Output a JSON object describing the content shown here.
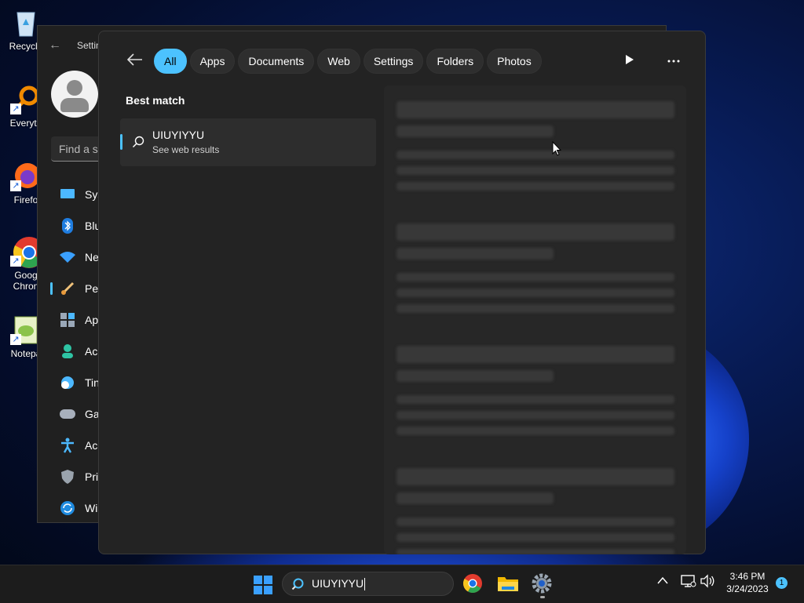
{
  "desktop": {
    "icons": [
      {
        "label": "Recycle",
        "icon": "recycle-bin-icon"
      },
      {
        "label": "Everyth",
        "icon": "everything-search-icon"
      },
      {
        "label": "Firefo",
        "icon": "firefox-icon"
      },
      {
        "label": "Goog\nChron",
        "icon": "chrome-icon"
      },
      {
        "label": "Notepa",
        "icon": "notepad-plus-icon"
      }
    ]
  },
  "settings": {
    "title": "Settin",
    "find_placeholder": "Find a se",
    "nav": [
      {
        "label": "Sys",
        "icon": "system-icon"
      },
      {
        "label": "Blu",
        "icon": "bluetooth-icon"
      },
      {
        "label": "Ne",
        "icon": "network-icon"
      },
      {
        "label": "Per",
        "icon": "personalization-icon",
        "active": true
      },
      {
        "label": "Ap",
        "icon": "apps-icon"
      },
      {
        "label": "Ac",
        "icon": "accounts-icon"
      },
      {
        "label": "Tin",
        "icon": "time-language-icon"
      },
      {
        "label": "Ga",
        "icon": "gaming-icon"
      },
      {
        "label": "Ac",
        "icon": "accessibility-icon"
      },
      {
        "label": "Pri",
        "icon": "privacy-icon"
      },
      {
        "label": "Wi",
        "icon": "windows-update-icon"
      }
    ]
  },
  "search_panel": {
    "filters": [
      "All",
      "Apps",
      "Documents",
      "Web",
      "Settings",
      "Folders",
      "Photos"
    ],
    "selected_filter": "All",
    "best_match_label": "Best match",
    "result": {
      "title": "UIUYIYYU",
      "subtitle": "See web results"
    }
  },
  "taskbar": {
    "search_text": "UIUYIYYU",
    "pinned": [
      "chrome-icon",
      "file-explorer-icon",
      "settings-icon"
    ],
    "time": "3:46 PM",
    "date": "3/24/2023",
    "notification_count": "1"
  },
  "colors": {
    "accent": "#4cc2ff",
    "panel_bg": "#232323",
    "taskbar_bg": "#1c1c1c"
  }
}
